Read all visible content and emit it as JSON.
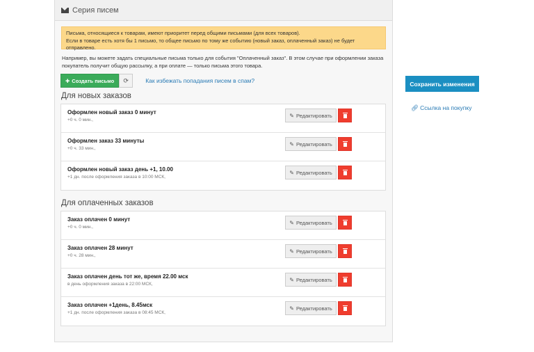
{
  "panel": {
    "title": "Серия писем",
    "warning": {
      "line1": "Письма, относящиеся к товарам, имеют приоритет перед общими письмами (для всех товаров).",
      "line2": "Если в товаре есть хотя бы 1 письмо, то общее письмо по тому же событию (новый заказ, оплаченный заказ) не будет",
      "line3": "отправлено."
    },
    "note": {
      "line1": "Например, вы можете задать специальные письма только для события \"Оплаченный заказ\". В этом случае при оформлении заказа",
      "line2": "покупатель получит общую рассылку, а при оплате — только письма этого товара."
    },
    "create_label": "Создать письмо",
    "spam_link": "Как избежать попадания писем в спам?"
  },
  "edit_label": "Редактировать",
  "new_orders": {
    "title": "Для новых заказов",
    "items": [
      {
        "title": "Оформлен новый заказ 0 минут",
        "sub": "+0 ч. 0 мин.,"
      },
      {
        "title": "Оформлен заказ 33 минуты",
        "sub": "+0 ч. 33 мин.,"
      },
      {
        "title": "Оформлен новый заказ день +1, 10.00",
        "sub": "+1 дн. после оформления заказа в 10:00 МСК,"
      }
    ]
  },
  "paid_orders": {
    "title": "Для оплаченных заказов",
    "items": [
      {
        "title": "Заказ оплачен 0 минут",
        "sub": "+0 ч. 0 мин.,"
      },
      {
        "title": "Заказ оплачен 28 минут",
        "sub": "+0 ч. 28 мин.,"
      },
      {
        "title": "Заказ оплачен день тот же, время 22.00 мск",
        "sub": "в день оформления заказа в 22:00 МСК,"
      },
      {
        "title": "Заказ оплачен +1день, 8.45мск",
        "sub": "+1 дн. после оформления заказа в 08:45 МСК,"
      }
    ]
  },
  "sidebar": {
    "save_label": "Сохранить изменения",
    "buy_link": "Ссылка на покупку"
  }
}
